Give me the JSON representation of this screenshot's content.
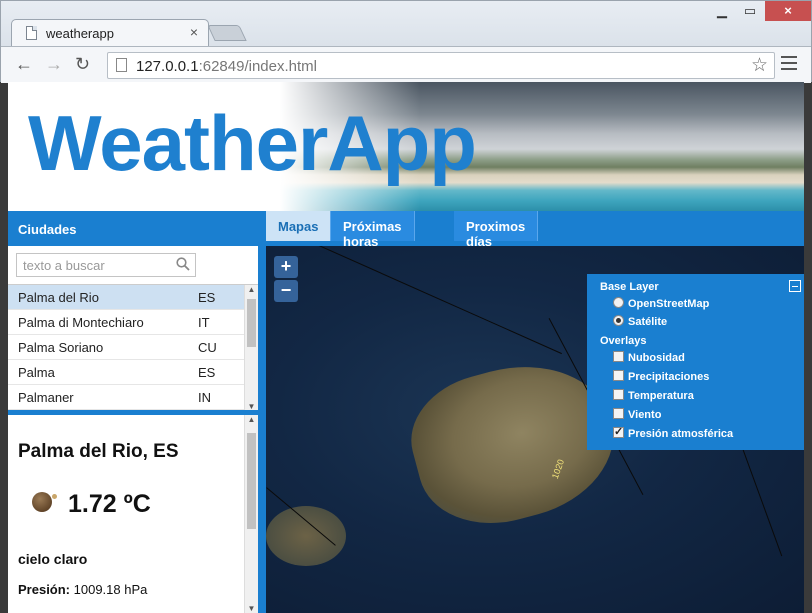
{
  "browser": {
    "tab_title": "weatherapp",
    "url_host": "127.0.0.1",
    "url_rest": ":62849/index.html"
  },
  "header": {
    "brand": "WeatherApp"
  },
  "cities": {
    "heading": "Ciudades",
    "search_placeholder": "texto a buscar",
    "items": [
      {
        "name": "Palma del Rio",
        "code": "ES",
        "selected": true
      },
      {
        "name": "Palma di Montechiaro",
        "code": "IT"
      },
      {
        "name": "Palma Soriano",
        "code": "CU"
      },
      {
        "name": "Palma",
        "code": "ES"
      },
      {
        "name": "Palmaner",
        "code": "IN"
      }
    ]
  },
  "detail": {
    "title": "Palma del Rio, ES",
    "temperature": "1.72 ºC",
    "description": "cielo claro",
    "pressure_label": "Presión:",
    "pressure_value": "1009.18 hPa"
  },
  "tabs": [
    {
      "label": "Mapas",
      "active": true
    },
    {
      "label": "Próximas horas"
    },
    {
      "label": "Proximos días"
    }
  ],
  "map": {
    "zoom_in": "+",
    "zoom_out": "−",
    "isobar_label": "1020",
    "layers": {
      "base_heading": "Base Layer",
      "base_options": [
        {
          "label": "OpenStreetMap",
          "checked": false
        },
        {
          "label": "Satélite",
          "checked": true
        }
      ],
      "overlay_heading": "Overlays",
      "overlay_options": [
        {
          "label": "Nubosidad",
          "checked": false
        },
        {
          "label": "Precipitaciones",
          "checked": false
        },
        {
          "label": "Temperatura",
          "checked": false
        },
        {
          "label": "Viento",
          "checked": false
        },
        {
          "label": "Presión atmosférica",
          "checked": true
        }
      ]
    }
  },
  "colors": {
    "accent": "#1a7fd0",
    "selected_row": "#cde0f2",
    "brand_text": "#1f80cf"
  }
}
